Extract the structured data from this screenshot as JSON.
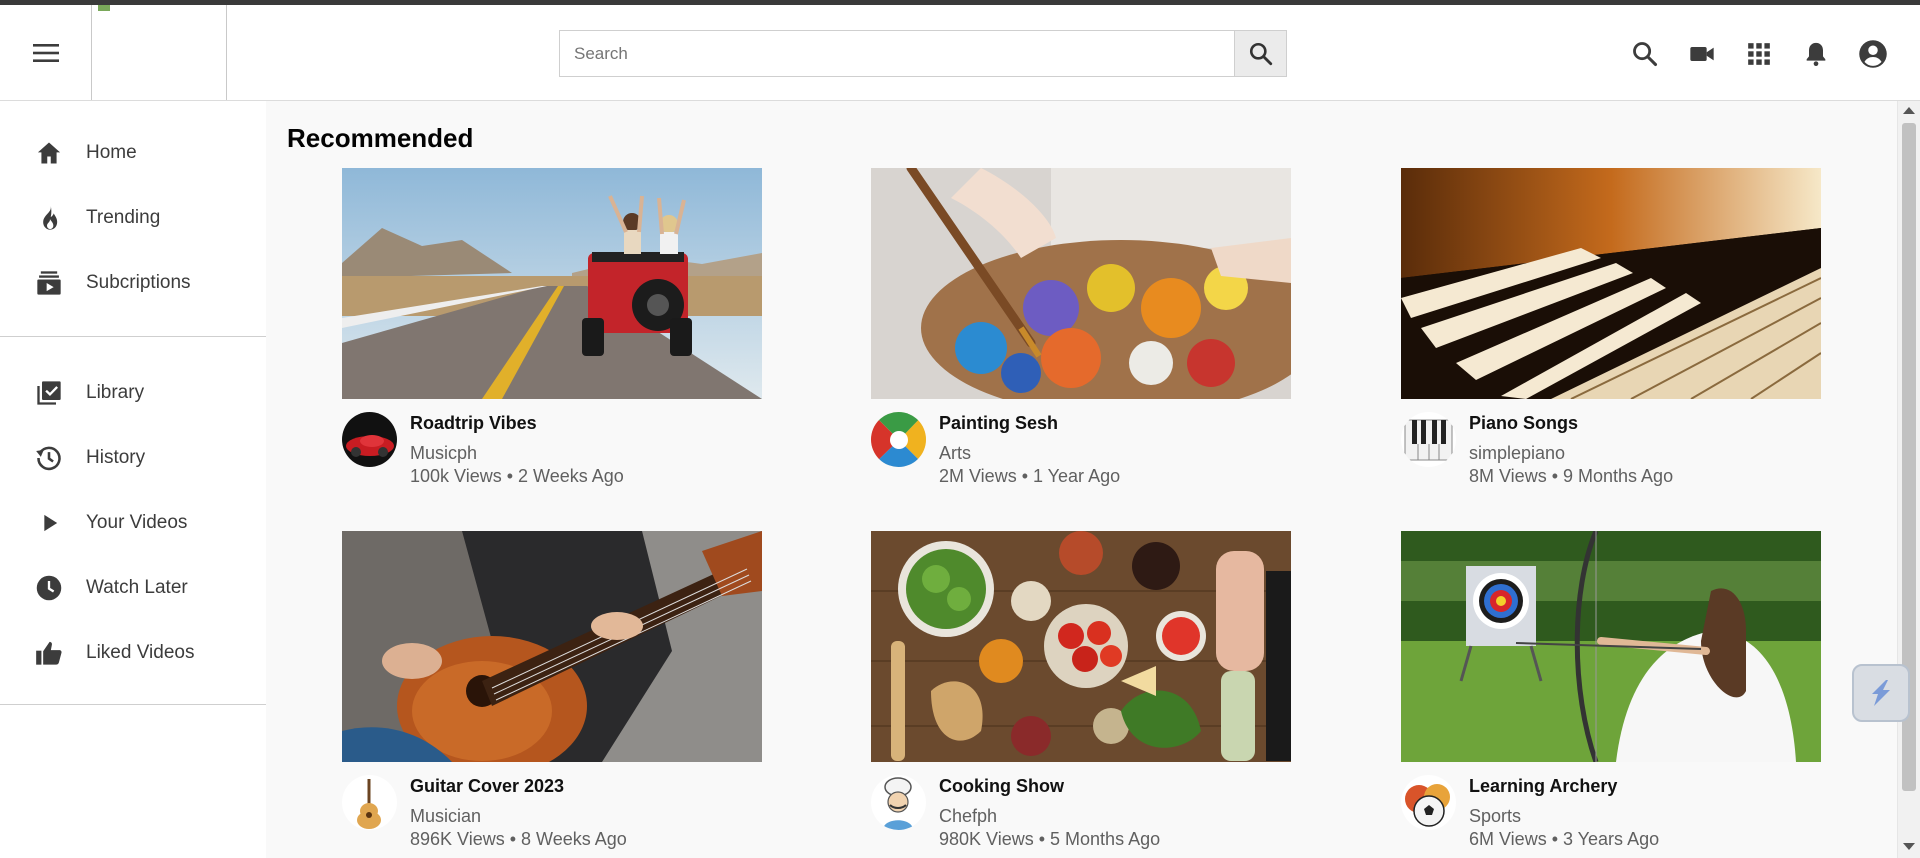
{
  "header": {
    "search": {
      "placeholder": "Search",
      "value": ""
    },
    "icons": [
      "menu-icon",
      "search-icon",
      "video-camera-icon",
      "apps-grid-icon",
      "bell-icon",
      "account-icon"
    ]
  },
  "sidebar": {
    "primary": [
      {
        "label": "Home",
        "icon": "home-icon"
      },
      {
        "label": "Trending",
        "icon": "flame-icon"
      },
      {
        "label": "Subcriptions",
        "icon": "subscriptions-icon"
      }
    ],
    "secondary": [
      {
        "label": "Library",
        "icon": "library-icon"
      },
      {
        "label": "History",
        "icon": "history-icon"
      },
      {
        "label": "Your Videos",
        "icon": "play-icon"
      },
      {
        "label": "Watch Later",
        "icon": "clock-icon"
      },
      {
        "label": "Liked Videos",
        "icon": "thumbs-up-icon"
      }
    ]
  },
  "main": {
    "section_title": "Recommended",
    "videos": [
      {
        "title": "Roadtrip Vibes",
        "channel": "Musicph",
        "stats": "100k Views • 2 Weeks Ago"
      },
      {
        "title": "Painting Sesh",
        "channel": "Arts",
        "stats": "2M Views • 1 Year Ago"
      },
      {
        "title": "Piano Songs",
        "channel": "simplepiano",
        "stats": "8M Views • 9 Months Ago"
      },
      {
        "title": "Guitar Cover 2023",
        "channel": "Musician",
        "stats": "896K Views • 8 Weeks Ago"
      },
      {
        "title": "Cooking Show",
        "channel": "Chefph",
        "stats": "980K Views • 5 Months Ago"
      },
      {
        "title": "Learning Archery",
        "channel": "Sports",
        "stats": "6M Views • 3 Years Ago"
      }
    ]
  },
  "colors": {
    "icon": "#3c3c3c",
    "text_primary": "#030303",
    "text_secondary": "#606060",
    "background": "#f9f9f9"
  }
}
